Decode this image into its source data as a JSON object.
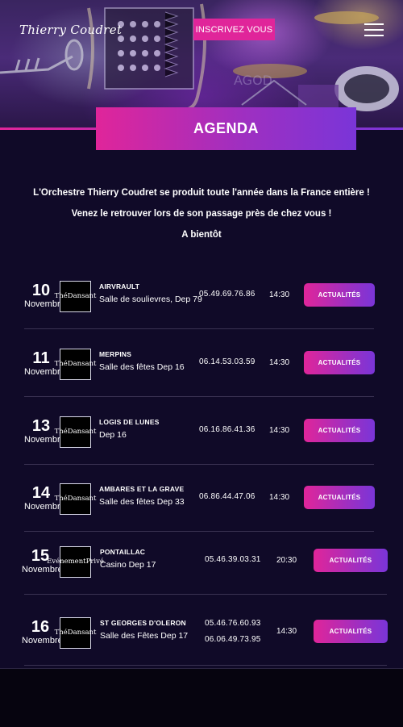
{
  "header": {
    "logo_text": "Thierry Coudret",
    "signup_label": "INSCRIVEZ VOUS",
    "title": "AGENDA",
    "accent_pink": "#e0259a",
    "accent_purple": "#7a35d8"
  },
  "intro": {
    "line1": "L'Orchestre Thierry Coudret se produit toute l'année dans la France entière !",
    "line2": "Venez le retrouver lors de son passage près de chez vous !",
    "line3": "A bientôt"
  },
  "events": [
    {
      "day": "10",
      "month": "Novembre",
      "thumb_line1": "Thé",
      "thumb_line2": "Dansant",
      "city": "AIRVRAULT",
      "venue": "Salle de soulievres, Dep 79",
      "phone1": "05.49.69.76.86",
      "phone2": "",
      "time": "14:30",
      "button": "ACTUALITÉS"
    },
    {
      "day": "11",
      "month": "Novembre",
      "thumb_line1": "Thé",
      "thumb_line2": "Dansant",
      "city": "MERPINS",
      "venue": "Salle des fêtes Dep 16",
      "phone1": "06.14.53.03.59",
      "phone2": "",
      "time": "14:30",
      "button": "ACTUALITÉS"
    },
    {
      "day": "13",
      "month": "Novembre",
      "thumb_line1": "Thé",
      "thumb_line2": "Dansant",
      "city": "LOGIS DE LUNES",
      "venue": "Dep 16",
      "phone1": "06.16.86.41.36",
      "phone2": "",
      "time": "14:30",
      "button": "ACTUALITÉS"
    },
    {
      "day": "14",
      "month": "Novembre",
      "thumb_line1": "Thé",
      "thumb_line2": "Dansant",
      "city": "AMBARES ET LA GRAVE",
      "venue": "Salle des fêtes Dep 33",
      "phone1": "06.86.44.47.06",
      "phone2": "",
      "time": "14:30",
      "button": "ACTUALITÉS"
    },
    {
      "day": "15",
      "month": "Novembre",
      "thumb_line1": "Evénement",
      "thumb_line2": "Privé",
      "city": "PONTAILLAC",
      "venue": "Casino Dep 17",
      "phone1": "05.46.39.03.31",
      "phone2": "",
      "time": "20:30",
      "button": "ACTUALITÉS"
    },
    {
      "day": "16",
      "month": "Novembre",
      "thumb_line1": "Thé",
      "thumb_line2": "Dansant",
      "city": "ST GEORGES D'OLERON",
      "venue": "Salle des Fêtes Dep 17",
      "phone1": "05.46.76.60.93",
      "phone2": "06.06.49.73.95",
      "time": "14:30",
      "button": "ACTUALITÉS"
    }
  ]
}
